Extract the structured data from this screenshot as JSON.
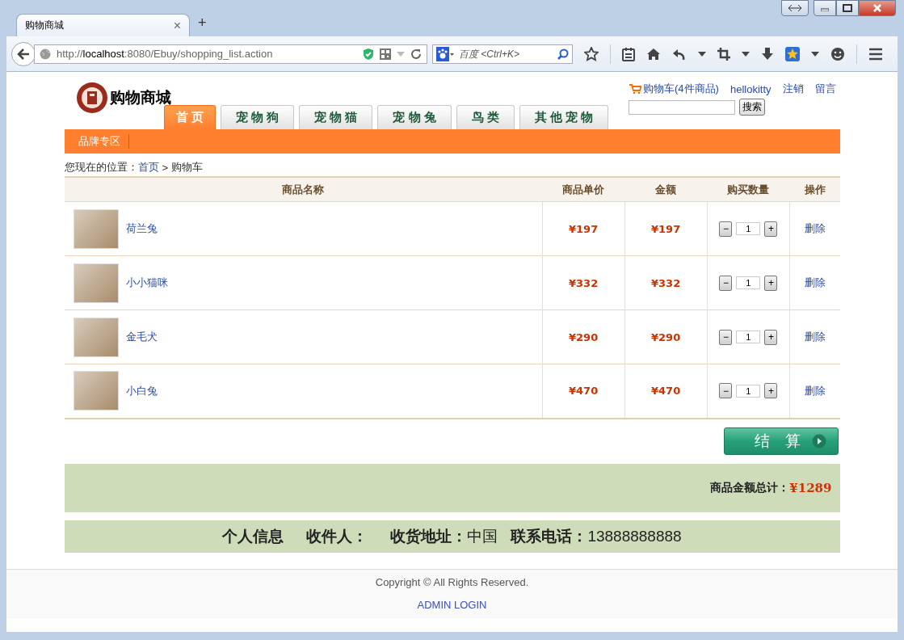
{
  "browser": {
    "tab_title": "购物商城",
    "tab_close": "×",
    "new_tab": "+",
    "url": "http://**localhost**:8080/Ebuy/shopping_list.action",
    "search_placeholder": "百度 <Ctrl+K>"
  },
  "header": {
    "logo_text": "购物商城",
    "nav_tabs": [
      {
        "label": "首 页",
        "selected": true
      },
      {
        "label": "宠 物 狗",
        "selected": false
      },
      {
        "label": "宠 物 猫",
        "selected": false
      },
      {
        "label": "宠 物 兔",
        "selected": false
      },
      {
        "label": "鸟 类",
        "selected": false
      },
      {
        "label": "其 他 宠 物",
        "selected": false
      }
    ],
    "cart_link": "购物车(4件商品)",
    "user_links": [
      "hellokitty",
      "注销",
      "留言"
    ],
    "search_button": "搜索"
  },
  "subnav": [
    "品牌专区"
  ],
  "breadcrumb": {
    "label": "您现在的位置：",
    "home": "首页",
    "separator": ">",
    "current": "购物车"
  },
  "table": {
    "columns": [
      "商品名称",
      "商品单价",
      "金额",
      "购买数量",
      "操作"
    ],
    "rows": [
      {
        "name": "荷兰兔",
        "price": "¥197",
        "amount": "¥197",
        "quantity": "1",
        "action": "删除"
      },
      {
        "name": "小小猫咪",
        "price": "¥332",
        "amount": "¥332",
        "quantity": "1",
        "action": "删除"
      },
      {
        "name": "金毛犬",
        "price": "¥290",
        "amount": "¥290",
        "quantity": "1",
        "action": "删除"
      },
      {
        "name": "小白兔",
        "price": "¥470",
        "amount": "¥470",
        "quantity": "1",
        "action": "删除"
      }
    ],
    "minus": "−",
    "plus": "+"
  },
  "checkout_button": "结　算",
  "total": {
    "label": "商品金额总计：",
    "value": "¥1289"
  },
  "personal_info": {
    "title": "个人信息",
    "recipient_label": "收件人：",
    "address_label": "收货地址：",
    "address": "中国",
    "phone_label": "联系电话：",
    "phone": "13888888888"
  },
  "footer": {
    "copyright": "Copyright © All Rights Reserved.",
    "admin_link": "ADMIN LOGIN"
  }
}
